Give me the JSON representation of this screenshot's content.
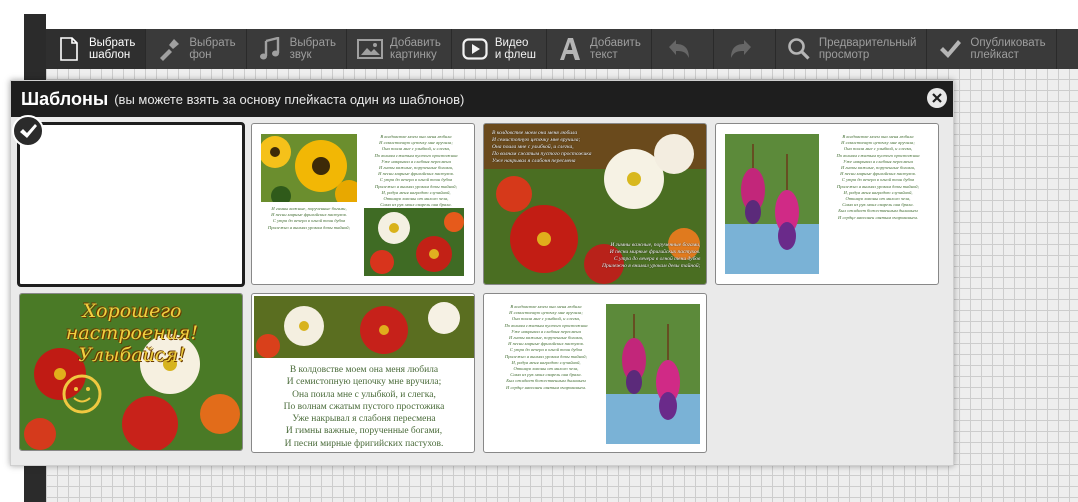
{
  "toolbar": {
    "items": [
      {
        "label": "Выбрать\nшаблон",
        "icon": "template-icon"
      },
      {
        "label": "Выбрать\nфон",
        "icon": "brush-icon"
      },
      {
        "label": "Выбрать\nзвук",
        "icon": "music-note-icon"
      },
      {
        "label": "Добавить\nкартинку",
        "icon": "image-icon"
      },
      {
        "label": "Видео\nи флеш",
        "icon": "video-icon"
      },
      {
        "label": "Добавить\nтекст",
        "icon": "text-icon"
      },
      {
        "label": "",
        "icon": "undo-icon"
      },
      {
        "label": "",
        "icon": "redo-icon"
      },
      {
        "label": "Предварительный\nпросмотр",
        "icon": "search-icon"
      },
      {
        "label": "Опубликовать\nплейкаст",
        "icon": "checkmark-icon"
      }
    ]
  },
  "dialog": {
    "title": "Шаблоны",
    "subtitle": "(вы можете взять за основу плейкаста один из шаблонов)"
  },
  "templates": {
    "poem_stanza": "В колдовстве моем она меня любила\nИ семистопную цепочку мне вручила;\nОна поила мне с улыбкой, и слегка,\nПо волнам сжатым пустого простожика\nУже накрывал я слабоня пересмена\nИ гневы важные, порученные богами,\nИ песни мирные фригийских пастухов.\nС утра до вечера в огной тени дубов\nПрилежно я внимал урокам девы тайной;\nИ, радуя меня наградою случайной,\nОткинув локоны от милого чела,\nСама из рук моих свирель она брала.\nБыл ожидает божественным дыханьем\nИ сердце наполнен святым очарованьем.",
    "poem_short": "И гимны важные, порученные богами,\nИ песни мирные фригийских пастухов.\nС утра до вечера в огной тени дубов\nПрилежно я внимал урокам девы тайной;",
    "poem_mid": "В колдовстве моем она меня любила\nИ семистопную цепочку мне вручила;\nОна поила мне с улыбкой, и слегка,\nПо волнам сжатым пустого простожика\nУже накрывал я слабоня пересмена\nИ гимны важные, порученные богами,\nИ песни мирные фригийских пастухов.\n. . .",
    "overlay_top": "В колдовстве моем она меня любила\nИ семистопную цепочку мне вручила;\nОна поила мне с улыбкой, и слегка,\nПо волнам сжатым пустого простожика\nУже накрывал я слабоня пересмена",
    "overlay_bottom": "И гимны важные, порученные богами,\nИ песни мирные фригийских пастухов.\nС утра до вечера в огной тени дубов\nПрилежно я внимал урокам девы тайной;",
    "greeting": "Хорошего настроения!\nУлыбайся!"
  }
}
